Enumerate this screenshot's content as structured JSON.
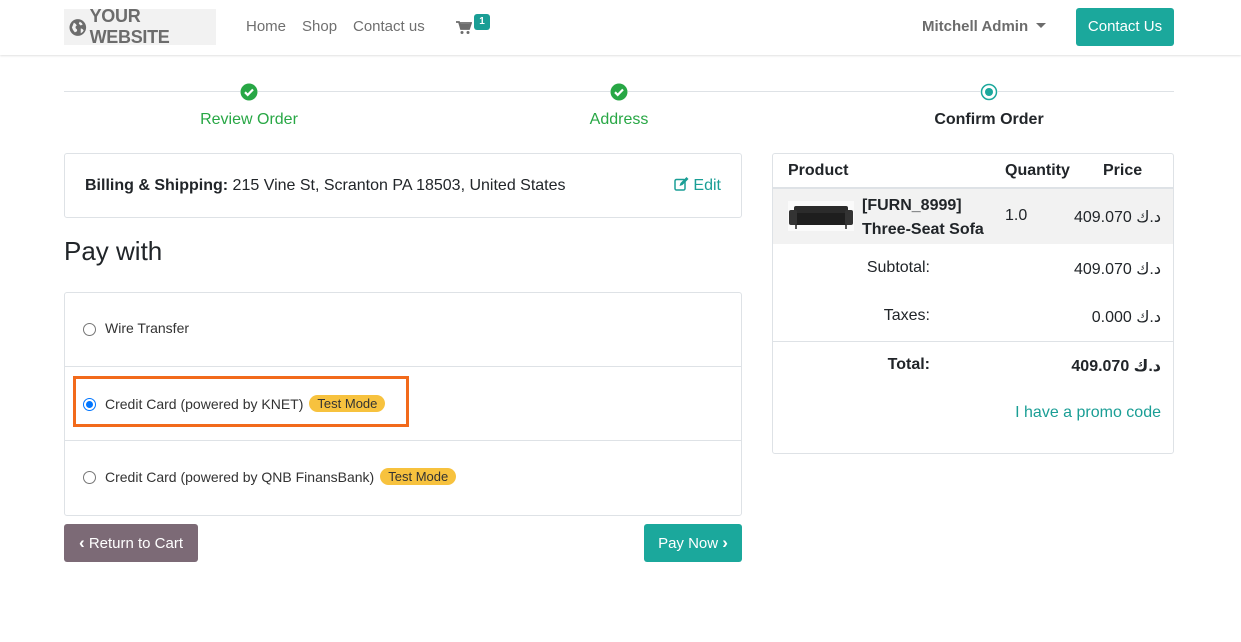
{
  "navbar": {
    "logo_text": "YOUR WEBSITE",
    "links": [
      "Home",
      "Shop",
      "Contact us"
    ],
    "cart_count": "1",
    "user_name": "Mitchell Admin",
    "contact_button": "Contact Us"
  },
  "wizard": {
    "steps": [
      {
        "label": "Review Order",
        "state": "done"
      },
      {
        "label": "Address",
        "state": "done"
      },
      {
        "label": "Confirm Order",
        "state": "current"
      }
    ]
  },
  "billing": {
    "label": "Billing & Shipping:",
    "address": "215 Vine St, Scranton PA 18503, United States",
    "edit_label": "Edit"
  },
  "payment": {
    "heading": "Pay with",
    "methods": [
      {
        "label": "Wire Transfer",
        "badge": "",
        "selected": false
      },
      {
        "label": "Credit Card (powered by KNET)",
        "badge": "Test Mode",
        "selected": true
      },
      {
        "label": "Credit Card (powered by QNB FinansBank)",
        "badge": "Test Mode",
        "selected": false
      }
    ],
    "return_button": "Return to Cart",
    "pay_button": "Pay Now"
  },
  "summary": {
    "headers": {
      "product": "Product",
      "quantity": "Quantity",
      "price": "Price"
    },
    "item": {
      "code": "[FURN_8999]",
      "name": "Three-Seat Sofa",
      "quantity": "1.0",
      "price": "409.070 د.ك"
    },
    "subtotal_label": "Subtotal:",
    "subtotal_value": "409.070 د.ك",
    "taxes_label": "Taxes:",
    "taxes_value": "0.000 د.ك",
    "total_label": "Total:",
    "total_value": "409.070 د.ك",
    "promo_label": "I have a promo code"
  },
  "colors": {
    "accent": "#1ba89c",
    "done": "#28a745",
    "highlight": "#f26a1b",
    "badge": "#f7c23e"
  }
}
